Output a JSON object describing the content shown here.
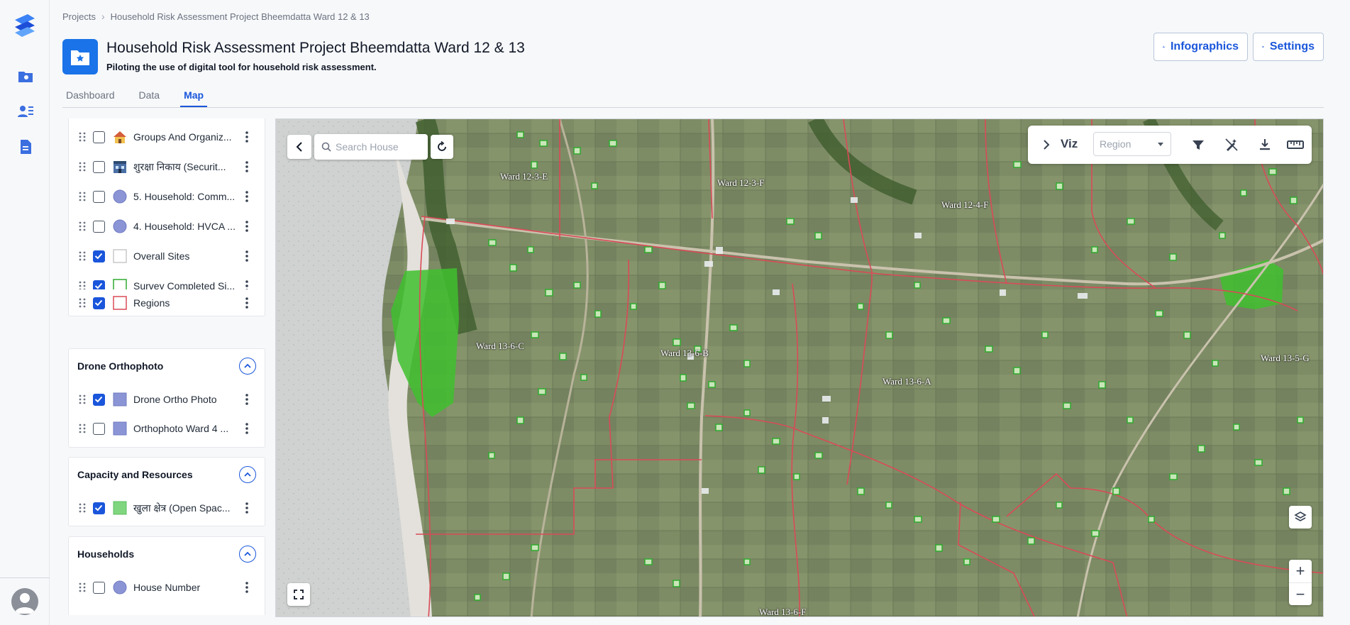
{
  "breadcrumb": {
    "root": "Projects",
    "current": "Household Risk Assessment Project Bheemdatta Ward 12 & 13"
  },
  "project": {
    "title": "Household Risk Assessment Project Bheemdatta Ward 12 & 13",
    "subtitle": "Piloting the use of digital tool for household risk assessment."
  },
  "header_buttons": {
    "infographics": "Infographics",
    "settings": "Settings"
  },
  "tabs": [
    {
      "label": "Dashboard",
      "active": false
    },
    {
      "label": "Data",
      "active": false
    },
    {
      "label": "Map",
      "active": true
    }
  ],
  "layers": {
    "top_group": [
      {
        "label": "Groups And Organiz...",
        "checked": false,
        "symbol": "house-icon"
      },
      {
        "label": "शुरक्षा निकाय (Securit...",
        "checked": false,
        "symbol": "police-station-icon"
      },
      {
        "label": "5. Household: Comm...",
        "checked": false,
        "symbol": "circle",
        "color": "#8b95d6"
      },
      {
        "label": "4. Household: HVCA ...",
        "checked": false,
        "symbol": "circle",
        "color": "#8b95d6"
      },
      {
        "label": "Overall Sites",
        "checked": true,
        "symbol": "square-outline",
        "color": "#c8c8c8"
      },
      {
        "label": "Survey Completed Si...",
        "checked": true,
        "symbol": "square-outline",
        "color": "#2eaa2e"
      },
      {
        "label": "Regions",
        "checked": true,
        "symbol": "square-outline",
        "color": "#d94b57"
      }
    ],
    "drone": {
      "title": "Drone Orthophoto",
      "items": [
        {
          "label": "Drone Ortho Photo",
          "checked": true,
          "color": "#8b95d6"
        },
        {
          "label": "Orthophoto Ward 4 ...",
          "checked": false,
          "color": "#8b95d6"
        }
      ]
    },
    "capacity": {
      "title": "Capacity and Resources",
      "items": [
        {
          "label": "खुला क्षेत्र (Open Spac...",
          "checked": true,
          "color": "#7fd67f"
        }
      ]
    },
    "households": {
      "title": "Households",
      "items": [
        {
          "label": "House Number",
          "checked": false,
          "color": "#8b95d6"
        }
      ]
    }
  },
  "map": {
    "search_placeholder": "Search House",
    "viz_label": "Viz",
    "viz_select": "Region",
    "ward_labels": [
      "Ward 12-3-E",
      "Ward 12-3-F",
      "Ward 12-4-F",
      "Ward 13-6-C",
      "Ward 13-6-B",
      "Ward 13-6-A",
      "Ward 13-5-G",
      "Ward 13-6-F"
    ],
    "zoom_in": "+",
    "zoom_out": "−"
  },
  "colors": {
    "accent": "#1a56db",
    "region_line": "#d94b57",
    "survey_outline": "#2eaa2e"
  }
}
